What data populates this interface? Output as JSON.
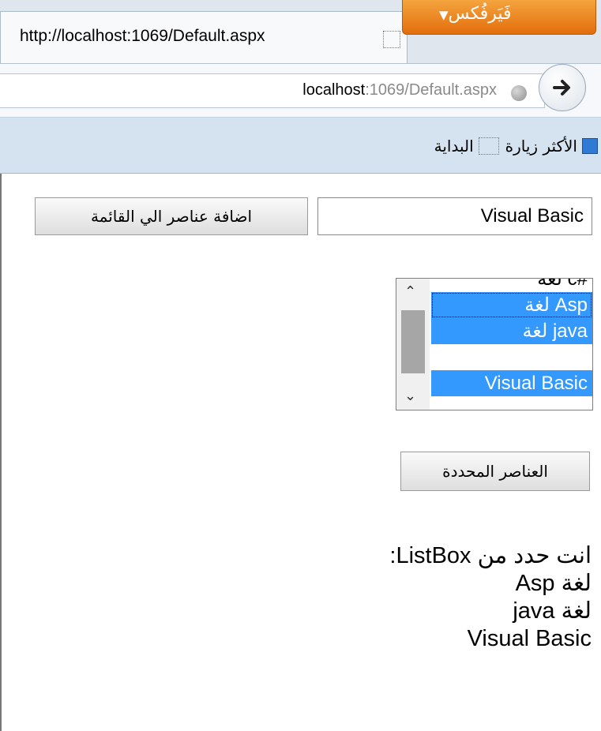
{
  "browser": {
    "menu_label": "فَيَرفُكس",
    "menu_arrow": "▼",
    "tab_title": "http://localhost:1069/Default.aspx",
    "url_host": "localhost",
    "url_path": ":1069/Default.aspx",
    "go_icon": "arrow-right-icon",
    "bookmarks": [
      {
        "label": "الأكثر زيارة",
        "icon": "most-visited-icon"
      },
      {
        "label": "البداية",
        "icon": "page-icon"
      }
    ]
  },
  "form": {
    "textbox_value": "Visual Basic",
    "add_button_label": "اضافة عناصر الي القائمة",
    "listbox_items": [
      {
        "text": "لغة c#",
        "selected": false
      },
      {
        "text": "لغة Asp",
        "selected": true
      },
      {
        "text": "لغة java",
        "selected": true
      },
      {
        "text": "",
        "selected": false
      },
      {
        "text": "Visual Basic",
        "selected": true
      }
    ],
    "selected_button_label": "العناصر المحددة",
    "result_lines": [
      "انت حدد من ListBox:",
      "لغة Asp",
      "لغة java",
      "Visual Basic"
    ]
  },
  "colors": {
    "selection": "#3399ff",
    "menu_orange": "#e8720c"
  }
}
